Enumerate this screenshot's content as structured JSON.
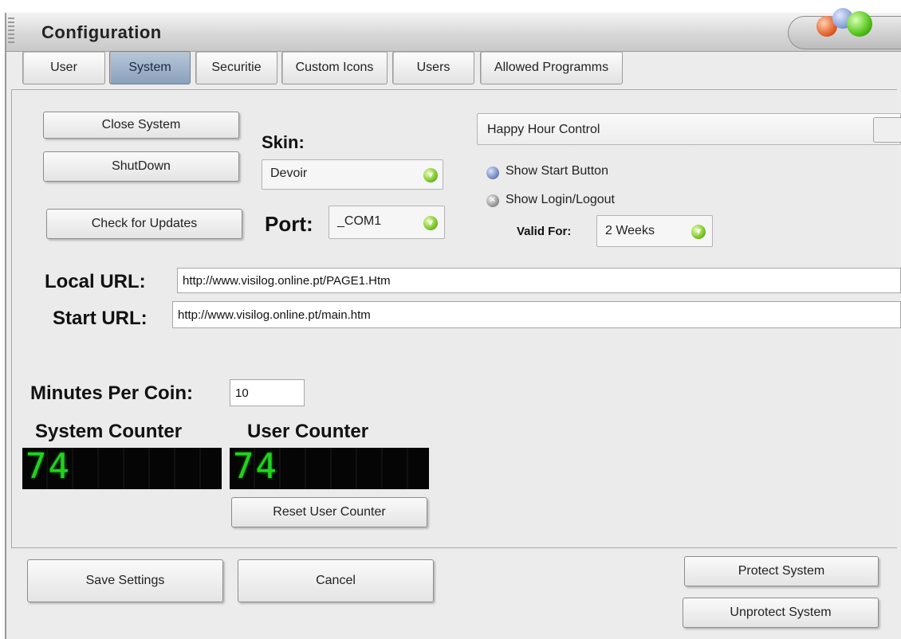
{
  "window": {
    "title": "Configuration"
  },
  "tabs": [
    {
      "label": "User",
      "active": false
    },
    {
      "label": "System",
      "active": true
    },
    {
      "label": "Securitie",
      "active": false
    },
    {
      "label": "Custom Icons",
      "active": false
    },
    {
      "label": "Users",
      "active": false
    },
    {
      "label": "Allowed Programms",
      "active": false
    }
  ],
  "system": {
    "close_system_label": "Close System",
    "shutdown_label": "ShutDown",
    "check_updates_label": "Check for Updates",
    "skin_label": "Skin:",
    "skin_value": "Devoir",
    "port_label": "Port:",
    "port_value": "_COM1",
    "happy_hour_label": "Happy Hour Control",
    "show_start_button_label": "Show Start Button",
    "show_login_logout_label": "Show Login/Logout",
    "valid_for_label": "Valid For:",
    "valid_for_value": "2 Weeks",
    "local_url_label": "Local URL:",
    "local_url_value": "http://www.visilog.online.pt/PAGE1.Htm",
    "start_url_label": "Start URL:",
    "start_url_value": "http://www.visilog.online.pt/main.htm",
    "minutes_per_coin_label": "Minutes Per Coin:",
    "minutes_per_coin_value": "10",
    "system_counter_label": "System Counter",
    "system_counter_value": "74",
    "user_counter_label": "User Counter",
    "user_counter_value": "74",
    "reset_user_counter_label": "Reset User Counter"
  },
  "footer": {
    "save_label": "Save Settings",
    "cancel_label": "Cancel",
    "protect_label": "Protect System",
    "unprotect_label": "Unprotect System"
  },
  "colors": {
    "active_tab": "#8aa0bb",
    "led_digits": "#22d21f",
    "led_background": "#050505",
    "combo_arrow": "#7cc62a"
  },
  "icons": {
    "combo_arrow": "green-down-arrow-icon",
    "radio_selected": "blue-radio-icon",
    "radio_crossed": "grey-x-radio-icon"
  }
}
